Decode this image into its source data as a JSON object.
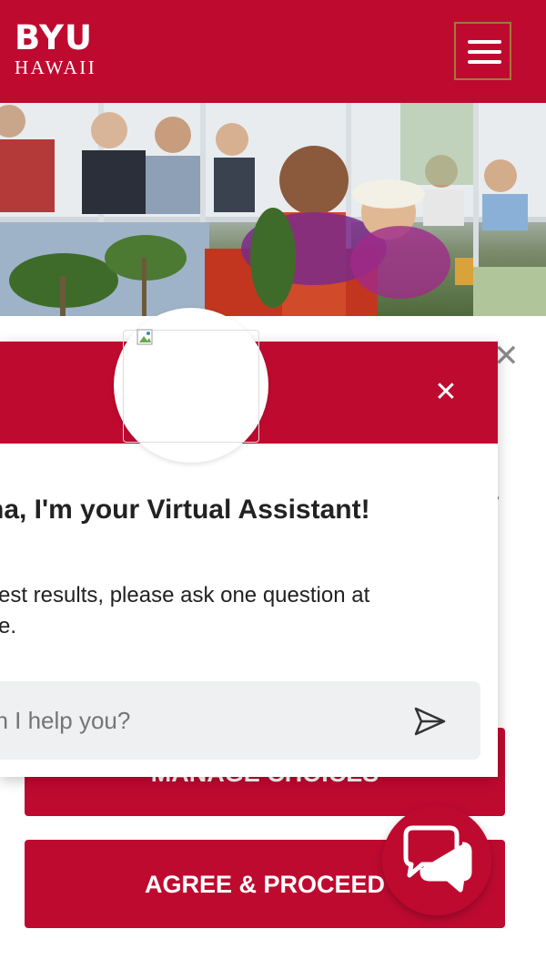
{
  "header": {
    "logo_primary": "BYU",
    "logo_secondary": "HAWAII",
    "menu_icon": "hamburger-menu-icon"
  },
  "hero": {
    "image_icon": "photo"
  },
  "cookie_banner": {
    "close_icon": "close-icon",
    "manage_label": "MANAGE CHOICES",
    "agree_label": "AGREE & PROCEED"
  },
  "chat": {
    "close_icon": "close-icon",
    "title": "ha, I'm your Virtual Assistant!",
    "subtitle_line1": "est results, please ask one question at",
    "subtitle_line2": "e.",
    "input_placeholder": "an I help you?",
    "send_icon": "send-icon",
    "fab_icon": "chat-bubbles-icon"
  },
  "colors": {
    "brand": "#bf0a30",
    "white": "#ffffff",
    "input_bg": "#eef0f2"
  }
}
